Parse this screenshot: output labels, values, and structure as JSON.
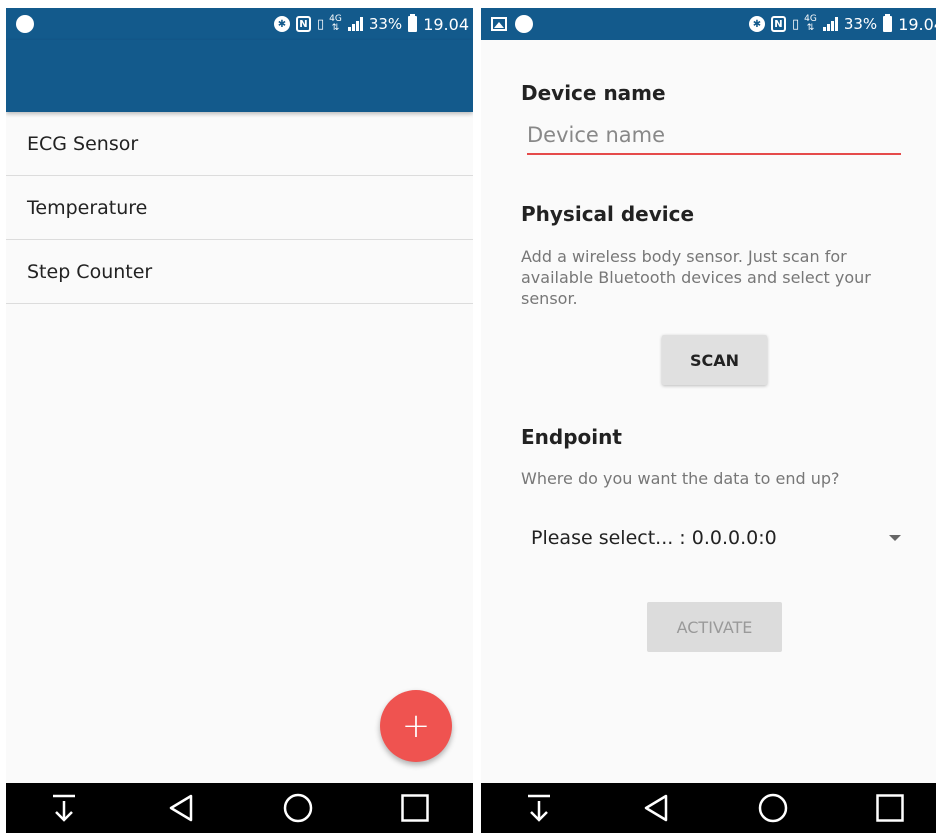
{
  "status_bar": {
    "battery": "33%",
    "time": "19.04",
    "bluetooth_icon": "bluetooth-icon",
    "nfc_icon": "nfc-icon",
    "vibrate_icon": "vibrate-icon",
    "network_type": "4G",
    "signal_icon": "signal-icon"
  },
  "list": {
    "items": [
      {
        "label": "ECG Sensor"
      },
      {
        "label": "Temperature"
      },
      {
        "label": "Step Counter"
      }
    ]
  },
  "fab": {
    "label": "+"
  },
  "form": {
    "device_name": {
      "title": "Device name",
      "placeholder": "Device name",
      "value": ""
    },
    "physical_device": {
      "title": "Physical device",
      "description": "Add a wireless body sensor. Just scan for available Bluetooth devices and select your sensor.",
      "scan_label": "SCAN"
    },
    "endpoint": {
      "title": "Endpoint",
      "description": "Where do you want the data to end up?",
      "selected": "Please select... : 0.0.0.0:0"
    },
    "activate_label": "ACTIVATE"
  },
  "colors": {
    "primary": "#135a8c",
    "accent": "#ef5350",
    "nav_bar": "#000000"
  }
}
